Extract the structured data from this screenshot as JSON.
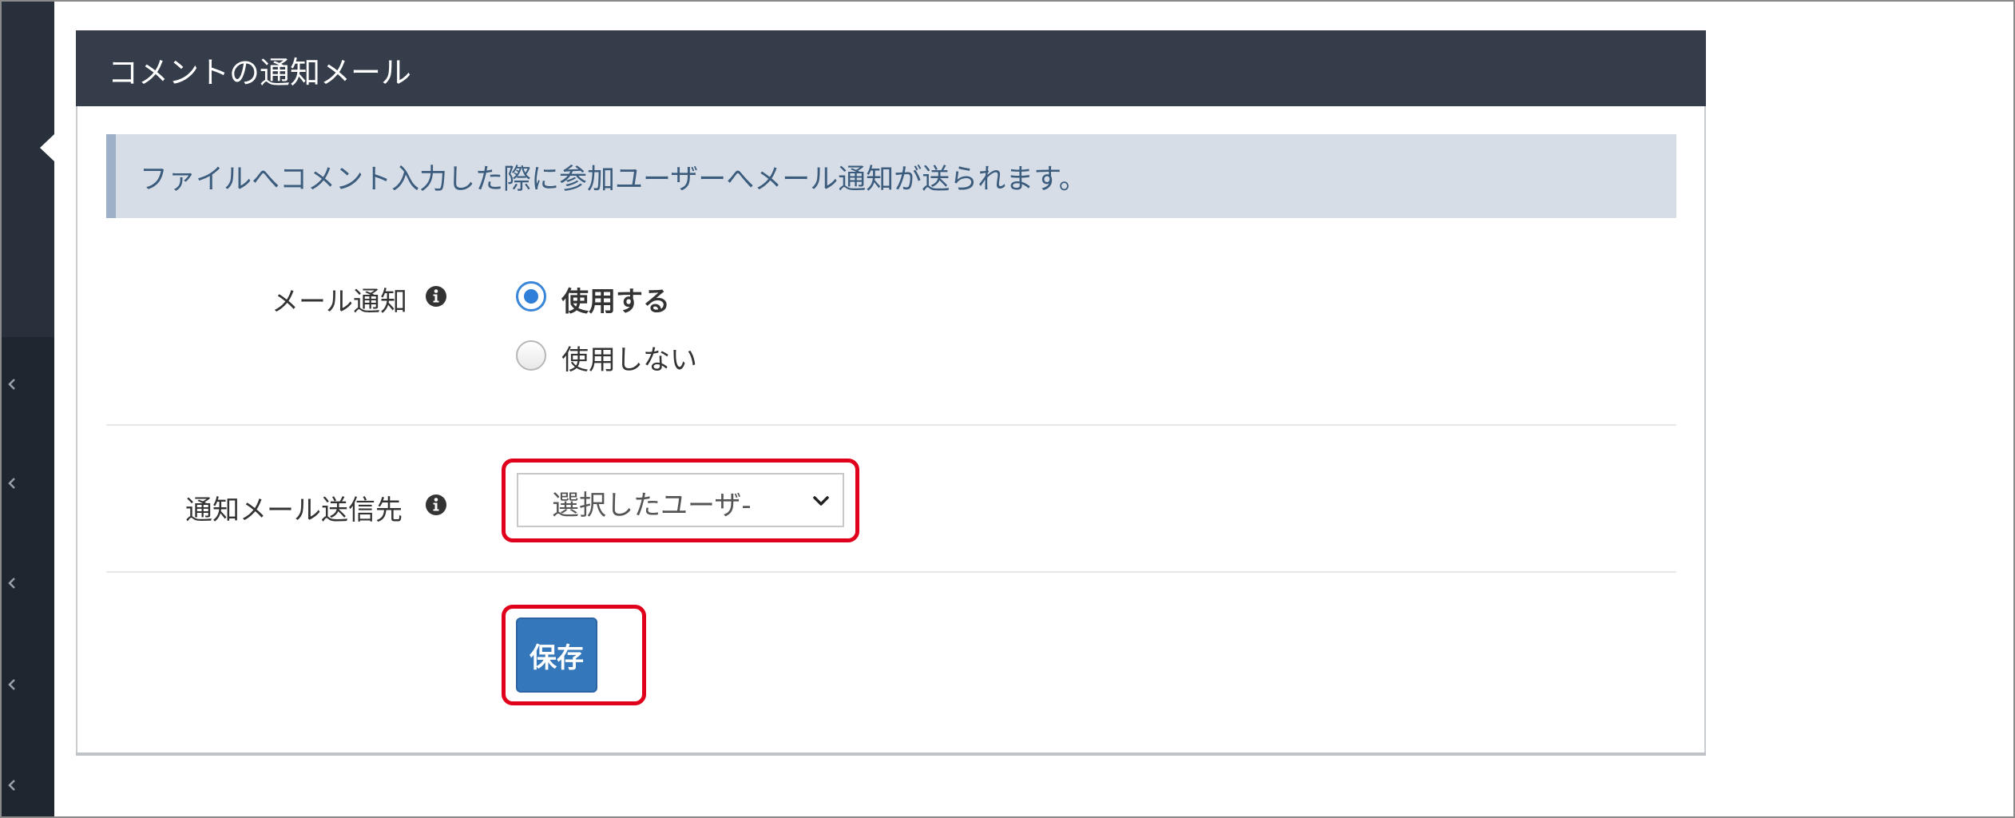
{
  "panel": {
    "title": "コメントの通知メール"
  },
  "alert": {
    "text": "ファイルへコメント入力した際に参加ユーザーへメール通知が送られます。"
  },
  "mail_notification": {
    "label": "メール通知",
    "info_icon": "info-circle-icon",
    "options": [
      {
        "label": "使用する",
        "checked": true
      },
      {
        "label": "使用しない",
        "checked": false
      }
    ]
  },
  "recipient": {
    "label": "通知メール送信先",
    "info_icon": "info-circle-icon",
    "selected_value": "選択したユーザ-"
  },
  "actions": {
    "save_label": "保存"
  },
  "sidebar": {
    "chevron_icon": "chevron-left-icon",
    "chevron_count": 5
  },
  "colors": {
    "header_bg": "#343d49",
    "alert_bg": "#d6dde7",
    "primary_button": "#3478bb",
    "highlight_border": "#e0001b",
    "radio_checked": "#2f7ed8"
  }
}
